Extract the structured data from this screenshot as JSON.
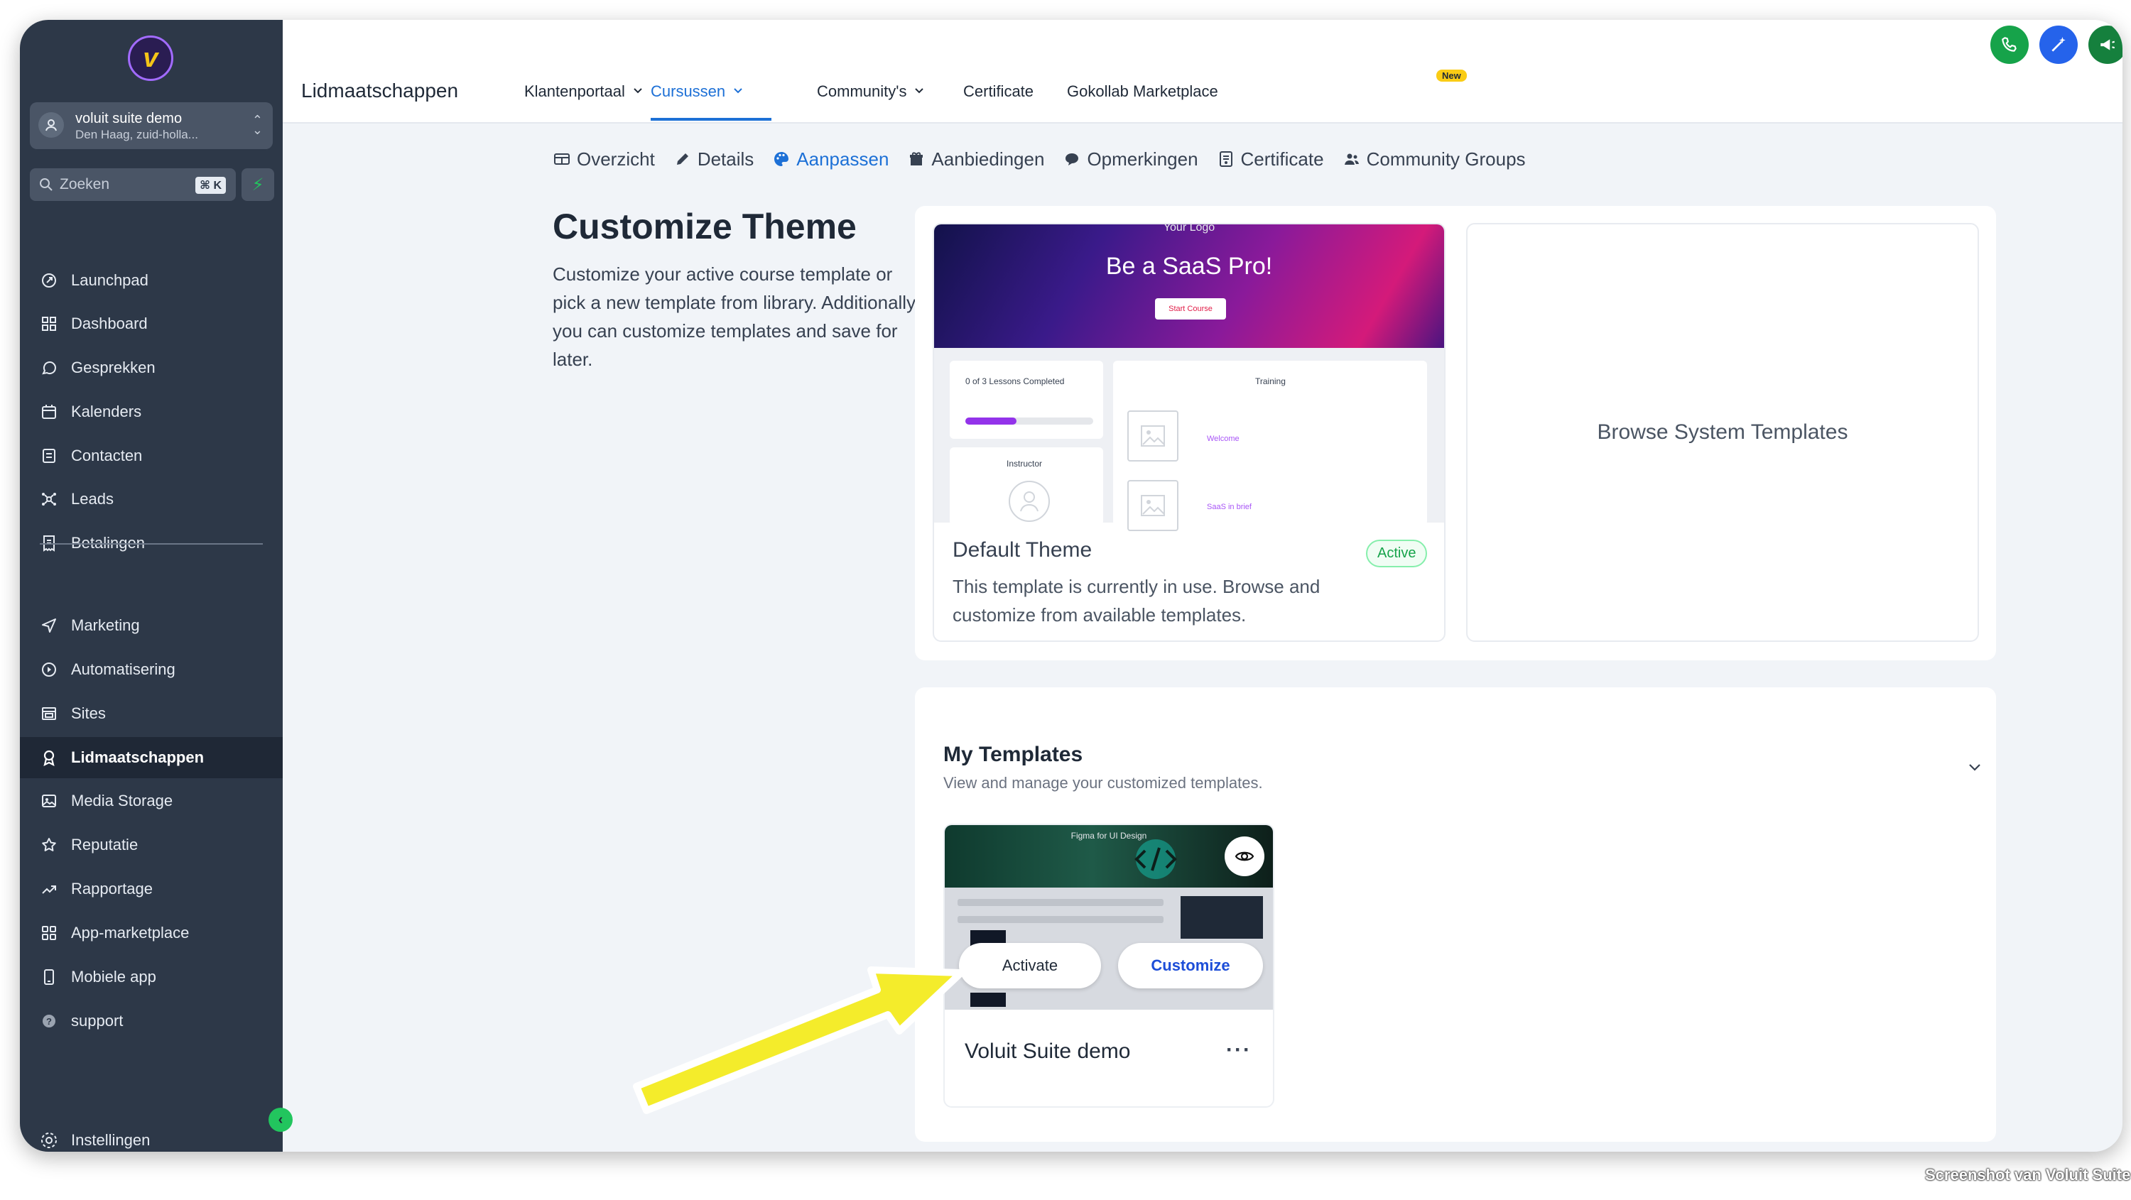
{
  "sidebar": {
    "account_name": "voluit suite demo",
    "account_location": "Den Haag, zuid-holla...",
    "search_placeholder": "Zoeken",
    "search_shortcut": "⌘ K",
    "items": [
      {
        "label": "Launchpad",
        "icon": "rocket-icon"
      },
      {
        "label": "Dashboard",
        "icon": "grid-icon"
      },
      {
        "label": "Gesprekken",
        "icon": "chat-icon"
      },
      {
        "label": "Kalenders",
        "icon": "calendar-icon"
      },
      {
        "label": "Contacten",
        "icon": "contacts-icon"
      },
      {
        "label": "Leads",
        "icon": "network-icon"
      },
      {
        "label": "Betalingen",
        "icon": "receipt-icon"
      },
      {
        "label": "Marketing",
        "icon": "send-icon"
      },
      {
        "label": "Automatisering",
        "icon": "automation-icon"
      },
      {
        "label": "Sites",
        "icon": "browser-icon"
      },
      {
        "label": "Lidmaatschappen",
        "icon": "award-icon",
        "active": true
      },
      {
        "label": "Media Storage",
        "icon": "image-icon"
      },
      {
        "label": "Reputatie",
        "icon": "star-icon"
      },
      {
        "label": "Rapportage",
        "icon": "chart-icon"
      },
      {
        "label": "App-marketplace",
        "icon": "apps-icon"
      },
      {
        "label": "Mobiele app",
        "icon": "phone-icon"
      },
      {
        "label": "support",
        "icon": "help-icon"
      }
    ],
    "settings_label": "Instellingen"
  },
  "topbar": {
    "title": "Lidmaatschappen",
    "nav": [
      {
        "label": "Klantenportaal",
        "dropdown": true
      },
      {
        "label": "Cursussen",
        "dropdown": true,
        "active": true
      },
      {
        "label": "Community's",
        "dropdown": true
      },
      {
        "label": "Certificate",
        "dropdown": false
      },
      {
        "label": "Gokollab Marketplace",
        "dropdown": false
      }
    ],
    "new_badge": "New"
  },
  "subtabs": [
    {
      "label": "Overzicht",
      "icon": "table-icon"
    },
    {
      "label": "Details",
      "icon": "pencil-icon"
    },
    {
      "label": "Aanpassen",
      "icon": "palette-icon",
      "active": true
    },
    {
      "label": "Aanbiedingen",
      "icon": "gift-icon"
    },
    {
      "label": "Opmerkingen",
      "icon": "comment-icon"
    },
    {
      "label": "Certificate",
      "icon": "certificate-icon"
    },
    {
      "label": "Community Groups",
      "icon": "users-icon"
    }
  ],
  "customize": {
    "title": "Customize Theme",
    "description": "Customize your active course template or pick a new template from library. Additionally you can customize templates and save for later."
  },
  "default_theme": {
    "preview": {
      "logo_text": "Your Logo",
      "hero_title": "Be a SaaS Pro!",
      "hero_button": "Start Course",
      "lessons_completed": "0 of 3 Lessons Completed",
      "progress": 0.4,
      "training": "Training",
      "instructor": "Instructor",
      "lesson_1": "Welcome",
      "lesson_2": "SaaS in brief"
    },
    "title": "Default Theme",
    "description": "This template is currently in use. Browse and customize from available templates.",
    "badge": "Active"
  },
  "browse": {
    "label": "Browse System Templates"
  },
  "my_templates": {
    "title": "My Templates",
    "description": "View and manage your customized templates.",
    "cards": [
      {
        "name": "Voluit Suite demo",
        "thumb_title": "Figma for UI Design",
        "activate_label": "Activate",
        "customize_label": "Customize",
        "more_label": "···"
      }
    ]
  },
  "colors": {
    "sidebar_bg": "#2d3848",
    "accent_blue": "#1d70d6",
    "active_green": "#16a34a",
    "arrow_yellow": "#f4ec2b"
  },
  "credit": "Screenshot van Voluit Suite"
}
